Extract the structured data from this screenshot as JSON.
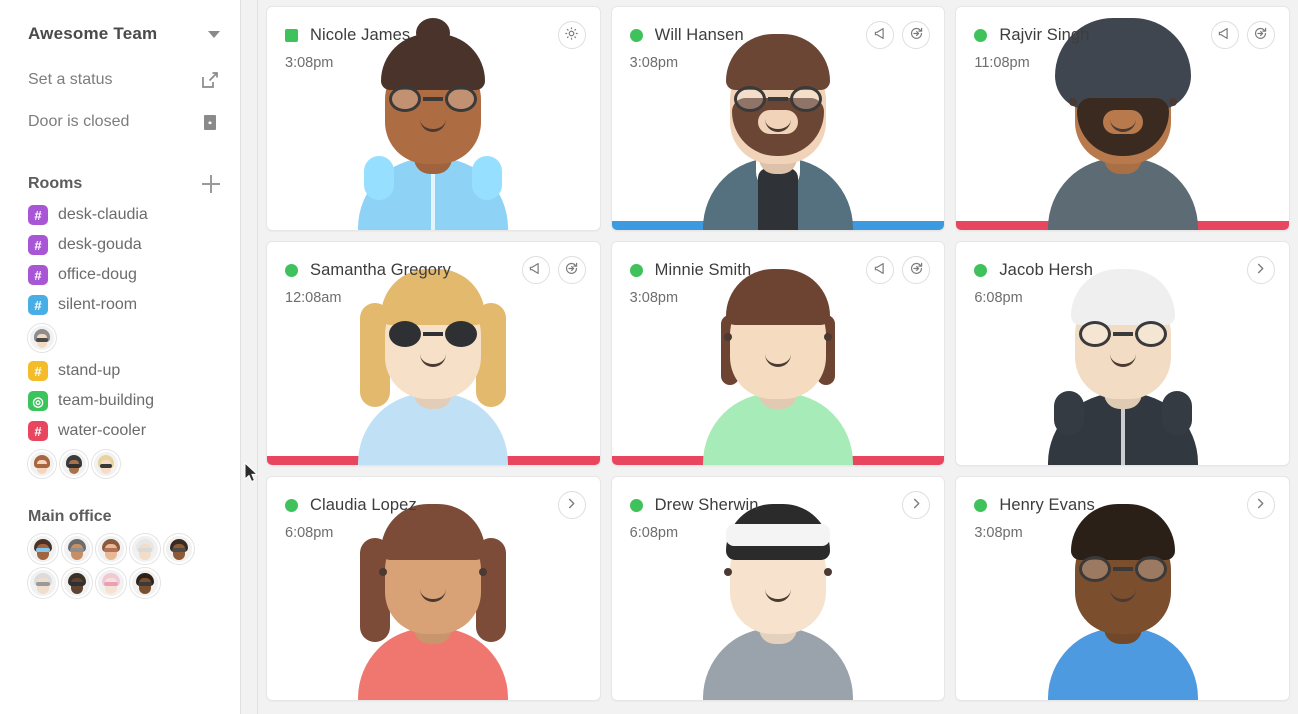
{
  "sidebar": {
    "team": {
      "name": "Awesome Team",
      "caret_icon": "chevron-down-icon"
    },
    "status": {
      "label": "Set a status",
      "icon": "edit-square-icon"
    },
    "door": {
      "label": "Door is closed",
      "icon": "door-closed-icon"
    },
    "rooms_header": {
      "label": "Rooms",
      "add_icon": "plus-icon"
    },
    "rooms": [
      {
        "name": "desk-claudia",
        "glyph": "#",
        "color": "#a855d6",
        "occupants": []
      },
      {
        "name": "desk-gouda",
        "glyph": "#",
        "color": "#a855d6",
        "occupants": []
      },
      {
        "name": "office-doug",
        "glyph": "#",
        "color": "#a855d6",
        "occupants": []
      },
      {
        "name": "silent-room",
        "glyph": "#",
        "color": "#49aee6",
        "occupants": [
          {
            "hair": "#8d8d8d",
            "skin": "#f2d9c4",
            "acc": "#4a4a4a"
          }
        ]
      },
      {
        "name": "stand-up",
        "glyph": "#",
        "color": "#f5bc2a",
        "occupants": []
      },
      {
        "name": "team-building",
        "glyph": "◎",
        "color": "#3bc45c",
        "occupants": []
      },
      {
        "name": "water-cooler",
        "glyph": "#",
        "color": "#e8455f",
        "occupants": [
          {
            "hair": "#a8663f",
            "skin": "#f6d4bd",
            "acc": "#a8663f"
          },
          {
            "hair": "#3b3b3b",
            "skin": "#a9714b",
            "acc": "#2f2f2f"
          },
          {
            "hair": "#e8d49a",
            "skin": "#f6dcc4",
            "acc": "#3a3a3a"
          }
        ]
      }
    ],
    "office": {
      "title": "Main office",
      "members": [
        {
          "hair": "#4a3326",
          "skin": "#a1643f",
          "acc": "#7fc8f0"
        },
        {
          "hair": "#6b6b6b",
          "skin": "#c98f63",
          "acc": "#8e8e8e"
        },
        {
          "hair": "#8a5a3c",
          "skin": "#e9b894",
          "acc": "#b4705a"
        },
        {
          "hair": "#e7e7e7",
          "skin": "#f3ddc8",
          "acc": "#d9d9d9"
        },
        {
          "hair": "#3a2a20",
          "skin": "#8d5a35",
          "acc": "#4a4a4a"
        },
        {
          "hair": "#dcdcdc",
          "skin": "#f0ddcc",
          "acc": "#9a9a9a"
        },
        {
          "hair": "#3a3028",
          "skin": "#5f4230",
          "acc": "#2e3033"
        },
        {
          "hair": "#f0c8d8",
          "skin": "#f7e2d2",
          "acc": "#e8a0b8"
        },
        {
          "hair": "#2e2118",
          "skin": "#7b4e2e",
          "acc": "#3a3a3a"
        }
      ]
    },
    "cursor_icon": "mouse-pointer-icon"
  },
  "people": [
    {
      "name": "Nicole James",
      "time": "3:08pm",
      "status_color": "#3fc15c",
      "status_shape": "square",
      "actions": [
        {
          "icon": "gear-icon"
        }
      ],
      "bar_color": null,
      "avatar": {
        "style": "bun",
        "skin": "#ad6c42",
        "hair": "#4a332a",
        "shirt": "#8ed2f5",
        "glasses": "clear",
        "hood": true
      }
    },
    {
      "name": "Will Hansen",
      "time": "3:08pm",
      "status_color": "#3fc15c",
      "status_shape": "circle",
      "actions": [
        {
          "icon": "megaphone-icon"
        },
        {
          "icon": "knock-enter-icon"
        }
      ],
      "bar_color": "#3d9ae0",
      "avatar": {
        "style": "beard",
        "skin": "#f0d3b8",
        "hair": "#6b4634",
        "shirt": "#55707e",
        "glasses": "clear",
        "collar": true,
        "tie": "#2f3338"
      }
    },
    {
      "name": "Rajvir Singh",
      "time": "11:08pm",
      "status_color": "#3fc15c",
      "status_shape": "circle",
      "actions": [
        {
          "icon": "megaphone-icon"
        },
        {
          "icon": "knock-enter-icon"
        }
      ],
      "bar_color": "#e8455f",
      "avatar": {
        "style": "turban",
        "skin": "#b87a4c",
        "hair": "#3f464f",
        "shirt": "#5c6b74",
        "glasses": "none",
        "bigbeard": "#3b2a20"
      }
    },
    {
      "name": "Samantha Gregory",
      "time": "12:08am",
      "status_color": "#3fc15c",
      "status_shape": "circle",
      "actions": [
        {
          "icon": "megaphone-icon"
        },
        {
          "icon": "knock-enter-icon"
        }
      ],
      "bar_color": "#e8455f",
      "avatar": {
        "style": "longhair",
        "skin": "#f6e0c8",
        "hair": "#e3b96e",
        "shirt": "#bfe0f5",
        "glasses": "shades"
      }
    },
    {
      "name": "Minnie Smith",
      "time": "3:08pm",
      "status_color": "#3fc15c",
      "status_shape": "circle",
      "actions": [
        {
          "icon": "megaphone-icon"
        },
        {
          "icon": "knock-enter-icon"
        }
      ],
      "bar_color": "#e8455f",
      "avatar": {
        "style": "curly",
        "skin": "#f5dcc0",
        "hair": "#6d4431",
        "shirt": "#a7ebb8",
        "glasses": "none"
      }
    },
    {
      "name": "Jacob Hersh",
      "time": "6:08pm",
      "status_color": "#3fc15c",
      "status_shape": "circle",
      "actions": [
        {
          "icon": "chevron-right-icon"
        }
      ],
      "bar_color": null,
      "avatar": {
        "style": "short",
        "skin": "#f2dcc4",
        "hair": "#efefef",
        "shirt": "#32383f",
        "glasses": "clear",
        "hood": true
      }
    },
    {
      "name": "Claudia Lopez",
      "time": "6:08pm",
      "status_color": "#3fc15c",
      "status_shape": "circle",
      "actions": [
        {
          "icon": "chevron-right-icon"
        }
      ],
      "bar_color": null,
      "avatar": {
        "style": "longhair",
        "skin": "#d9a276",
        "hair": "#7c4c38",
        "shirt": "#f0776f",
        "glasses": "none"
      }
    },
    {
      "name": "Drew Sherwin",
      "time": "6:08pm",
      "status_color": "#3fc15c",
      "status_shape": "circle",
      "actions": [
        {
          "icon": "chevron-right-icon"
        }
      ],
      "bar_color": null,
      "avatar": {
        "style": "bandana",
        "skin": "#f7e3cd",
        "hair": "#2b2b2b",
        "shirt": "#9aa3ab",
        "glasses": "none"
      }
    },
    {
      "name": "Henry Evans",
      "time": "3:08pm",
      "status_color": "#3fc15c",
      "status_shape": "circle",
      "actions": [
        {
          "icon": "chevron-right-icon"
        }
      ],
      "bar_color": null,
      "avatar": {
        "style": "short",
        "skin": "#7b4e2e",
        "hair": "#2b2018",
        "shirt": "#4e9ae0",
        "glasses": "clear"
      }
    }
  ]
}
